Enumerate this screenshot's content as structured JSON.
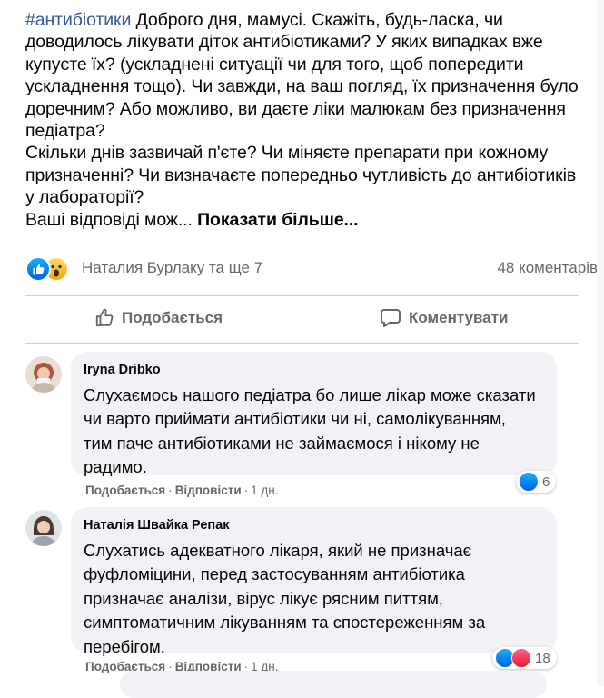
{
  "post": {
    "hashtag": "#антибіотики",
    "text_1": " Доброго дня, мамусі. Скажіть, будь-ласка, чи доводилось лікувати діток антибіотиками? У яких випадках вже купуєте їх? (ускладнені ситуації чи для того, щоб попередити ускладнення тощо). Чи завжди, на ваш погляд, їх призначення було доречним?  Або можливо, ви даєте ліки малюкам без призначення педіатра?",
    "text_2": "Скільки днів зазвичай п'єте? Чи міняєте препарати при кожному призначенні?  Чи визначаєте попередньо чутливість до антибіотиків у лабораторії?",
    "text_3": " Ваші відповіді мож...",
    "see_more": "Показати більше..."
  },
  "reactions": {
    "names": "Наталия Бурлаку та ще 7",
    "comments_count": "48 коментарів",
    "icons": [
      "like-reaction",
      "wow-reaction"
    ]
  },
  "actions": {
    "like_label": "Подобається",
    "comment_label": "Коментувати"
  },
  "comments": [
    {
      "author": "Iryna Dribko",
      "text": "Слухаємось нашого педіатра бо лише лікар може сказати чи варто приймати антибіотики чи ні, самолікуванням, тим паче антибіотиками не займаємося і нікому не радимо.",
      "like_label": "Подобається",
      "reply_label": "Відповісти",
      "time": "1 дн.",
      "reaction_count": "6",
      "reaction_icons": [
        "like-reaction"
      ]
    },
    {
      "author": "Наталія Швайка Репак",
      "text": "Слухатись адекватного лікаря, який не призначає фуфломіцини, перед застосуванням антибіотика призначає аналізи, вірус лікує рясним питтям, симптоматичним лікуванням та спостереженням за перебігом.",
      "like_label": "Подобається",
      "reply_label": "Відповісти",
      "time": "1 дн.",
      "reaction_count": "18",
      "reaction_icons": [
        "like-reaction",
        "love-reaction"
      ]
    }
  ],
  "colors": {
    "hashtag": "#385898",
    "secondary_text": "#65676b",
    "bubble": "#f0f2f5",
    "like_blue": "#1877f2"
  }
}
